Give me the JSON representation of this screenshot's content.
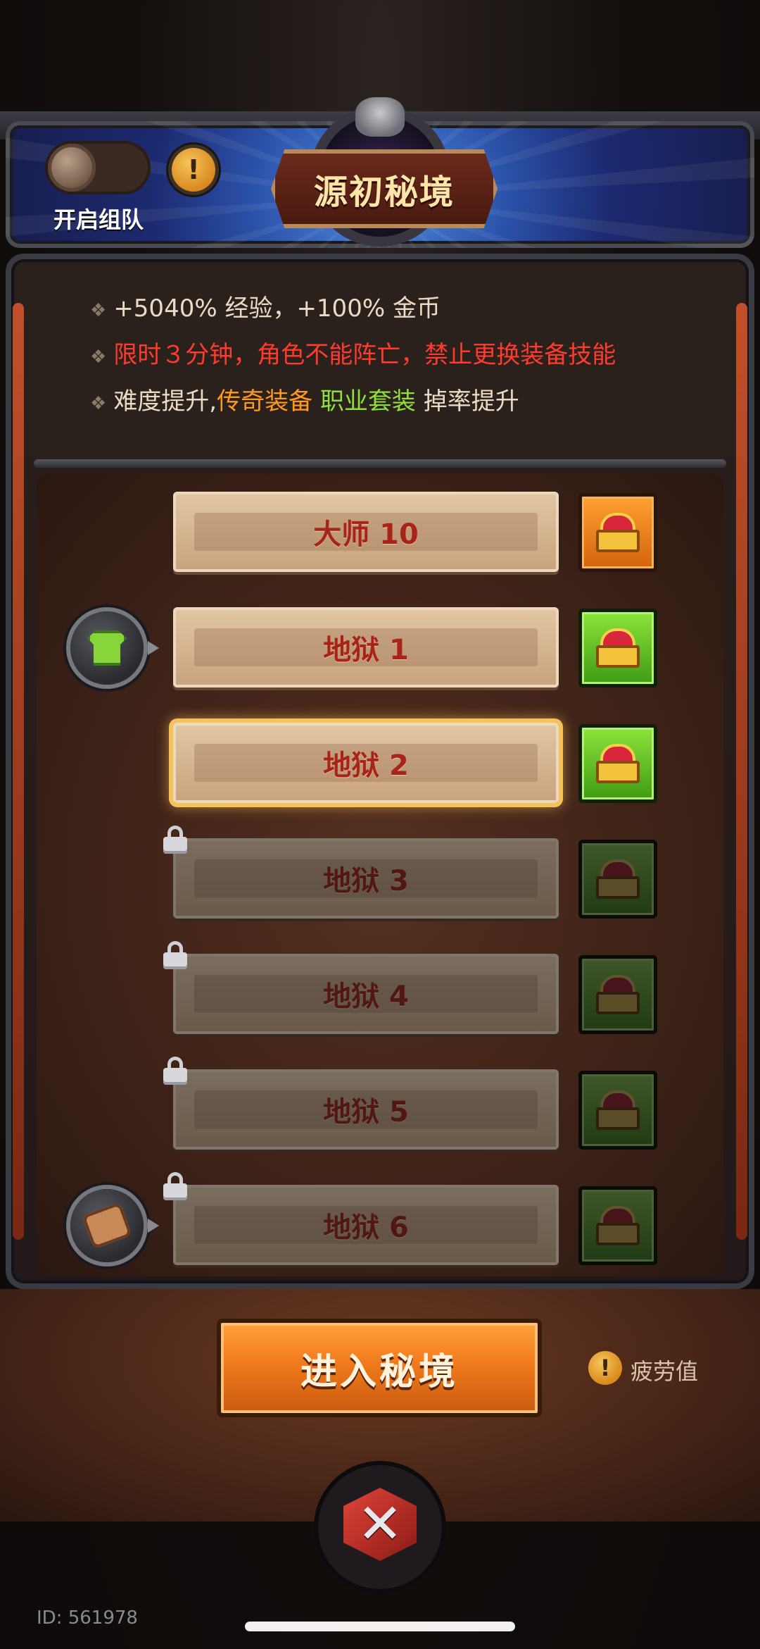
{
  "header": {
    "team_toggle_label": "开启组队",
    "info_icon": "!",
    "title": "源初秘境"
  },
  "bonus_info": {
    "line1": "+5040% 经验，+100% 金币",
    "line2": "限时３分钟，角色不能阵亡，禁止更换装备技能",
    "line3_part1": "难度提升,",
    "line3_part2": "传奇装备",
    "line3_part3": "职业套装",
    "line3_part4": "掉率提升",
    "bullet": "❖"
  },
  "levels": [
    {
      "label": "大师 10",
      "locked": false,
      "selected": false,
      "chest": "orange"
    },
    {
      "label": "地狱 1",
      "locked": false,
      "selected": false,
      "chest": "green"
    },
    {
      "label": "地狱 2",
      "locked": false,
      "selected": true,
      "chest": "green"
    },
    {
      "label": "地狱 3",
      "locked": true,
      "selected": false,
      "chest": "green"
    },
    {
      "label": "地狱 4",
      "locked": true,
      "selected": false,
      "chest": "green"
    },
    {
      "label": "地狱 5",
      "locked": true,
      "selected": false,
      "chest": "green"
    },
    {
      "label": "地狱 6",
      "locked": true,
      "selected": false,
      "chest": "green"
    }
  ],
  "footer": {
    "enter_button": "进入秘境",
    "fatigue_icon": "!",
    "fatigue_label": "疲劳值",
    "emblem_glyph": "✕",
    "id_label": "ID: 561978"
  },
  "colors": {
    "accent_orange": "#f07a1c",
    "warning_red": "#ff3b2f",
    "legendary_orange": "#ff9a1e",
    "set_green": "#8fe03a"
  },
  "icons": {
    "team_toggle": "toggle-icon",
    "info": "info-icon",
    "reward_row2": "shirt-icon",
    "reward_row7": "scroll-icon",
    "chest": "treasure-chest-icon",
    "lock": "lock-icon",
    "fatigue": "info-icon",
    "bottom_emblem": "crossed-swords-cube-icon"
  }
}
